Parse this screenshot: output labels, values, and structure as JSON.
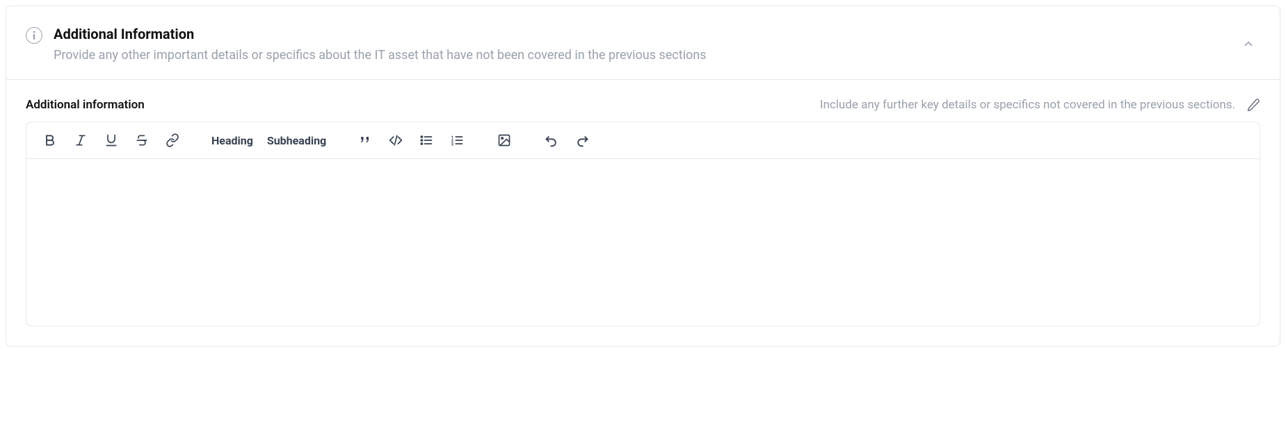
{
  "section": {
    "title": "Additional Information",
    "description": "Provide any other important details or specifics about the IT asset that have not been covered in the previous sections"
  },
  "field": {
    "label": "Additional information",
    "hint": "Include any further key details or specifics not covered in the previous sections."
  },
  "toolbar": {
    "heading": "Heading",
    "subheading": "Subheading"
  },
  "editor": {
    "content": ""
  }
}
